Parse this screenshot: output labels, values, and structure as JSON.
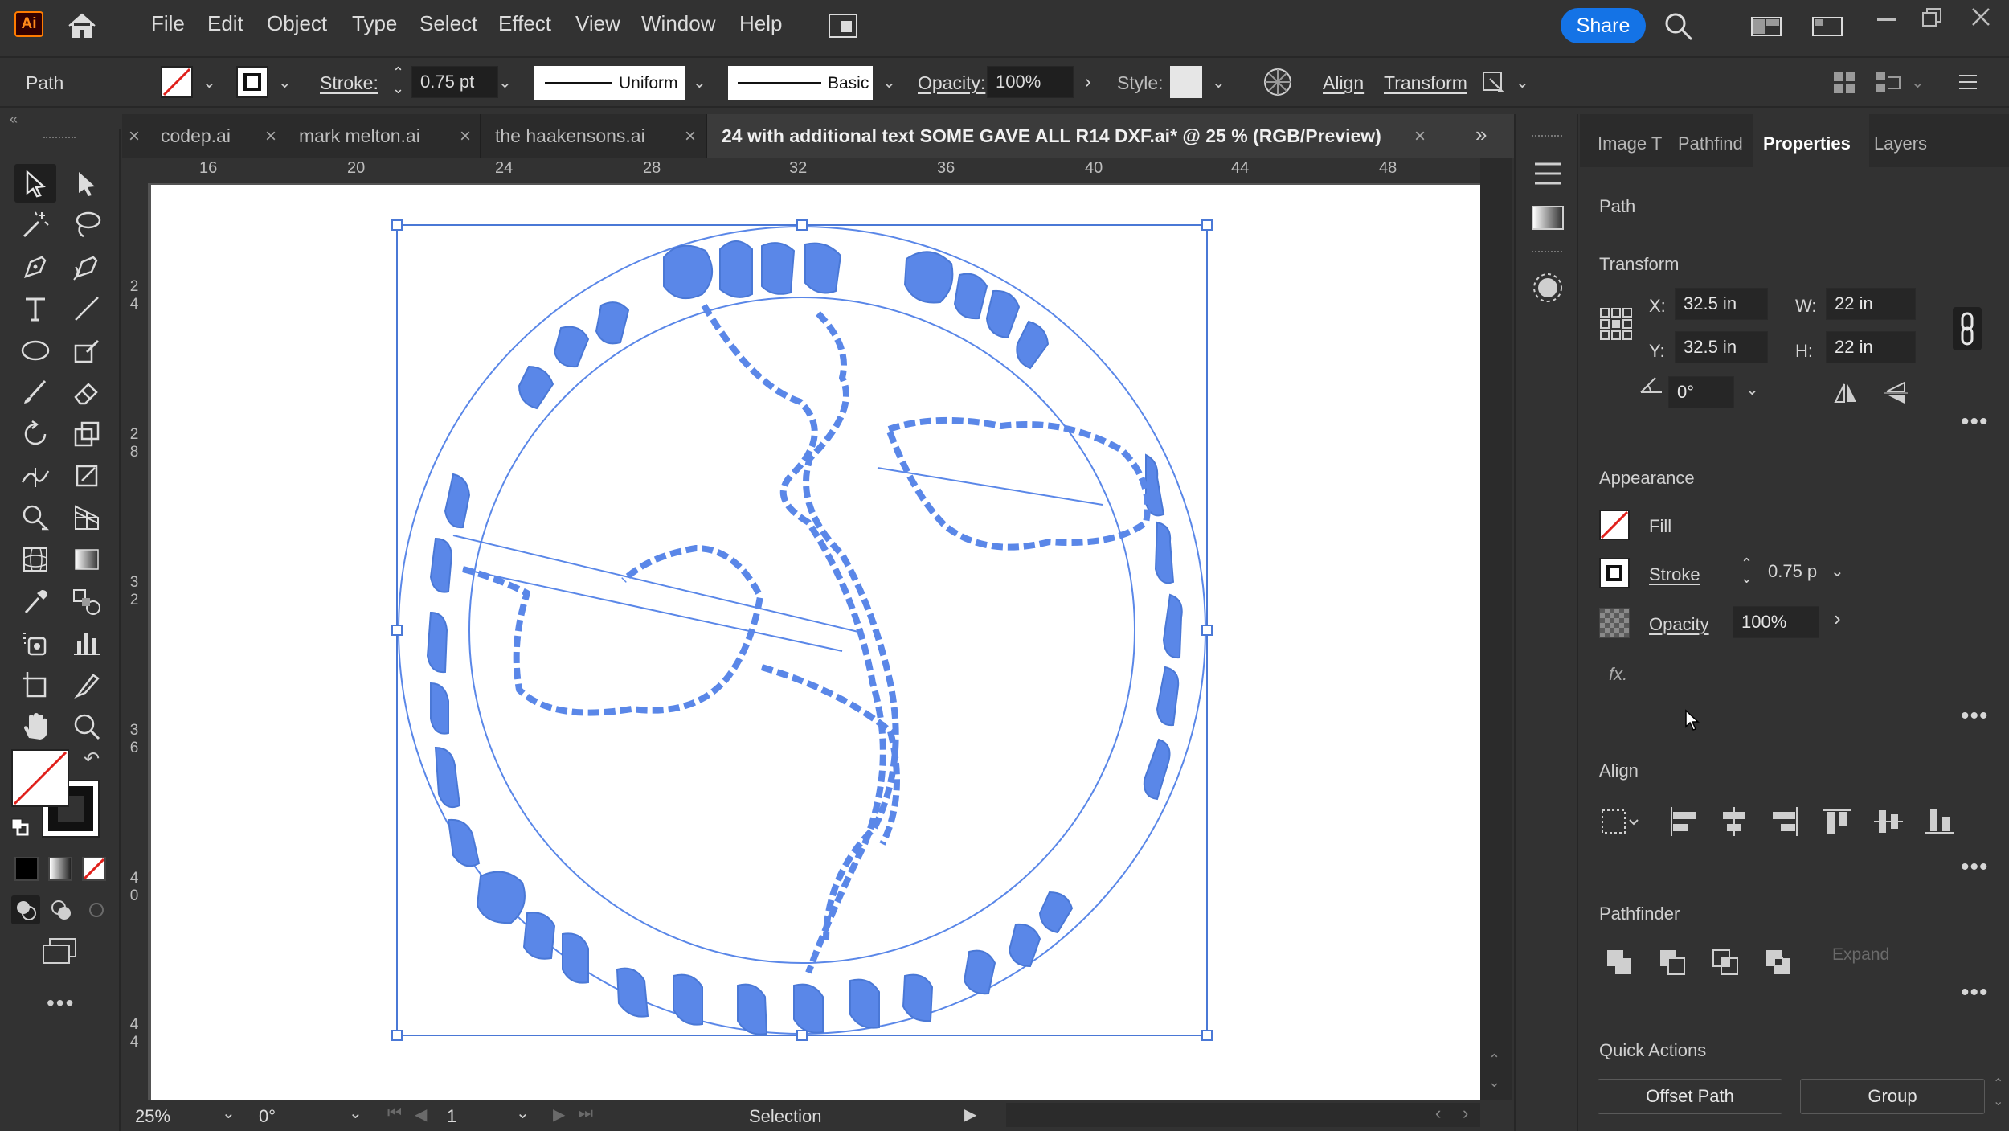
{
  "app": {
    "logo": "Ai",
    "share_label": "Share"
  },
  "menu": [
    "File",
    "Edit",
    "Object",
    "Type",
    "Select",
    "Effect",
    "View",
    "Window",
    "Help"
  ],
  "control": {
    "selection_type": "Path",
    "stroke_label": "Stroke:",
    "stroke_value": "0.75 pt",
    "profile": "Uniform",
    "brush": "Basic",
    "opacity_label": "Opacity:",
    "opacity_value": "100%",
    "style_label": "Style:",
    "align_label": "Align",
    "transform_label": "Transform"
  },
  "tabs": [
    {
      "label": "codep.ai",
      "active": false
    },
    {
      "label": "mark melton.ai",
      "active": false
    },
    {
      "label": "the haakensons.ai",
      "active": false
    },
    {
      "label": "24 with additional text SOME GAVE ALL R14 DXF.ai* @ 25 % (RGB/Preview)",
      "active": true
    }
  ],
  "ruler": {
    "h": [
      "16",
      "20",
      "24",
      "28",
      "32",
      "36",
      "40",
      "44",
      "48"
    ],
    "v": [
      [
        "2",
        "4"
      ],
      [
        "2",
        "8"
      ],
      [
        "3",
        "2"
      ],
      [
        "3",
        "6"
      ],
      [
        "4",
        "0"
      ],
      [
        "4",
        "4"
      ]
    ]
  },
  "status": {
    "zoom": "25%",
    "rotation": "0°",
    "artboard": "1",
    "tool": "Selection"
  },
  "panel": {
    "tabs": [
      "Image T",
      "Pathfind",
      "Properties",
      "Layers"
    ],
    "active_tab": "Properties",
    "object_type": "Path",
    "transform": {
      "title": "Transform",
      "x_label": "X:",
      "x": "32.5 in",
      "y_label": "Y:",
      "y": "32.5 in",
      "w_label": "W:",
      "w": "22 in",
      "h_label": "H:",
      "h": "22 in",
      "angle": "0°"
    },
    "appearance": {
      "title": "Appearance",
      "fill_label": "Fill",
      "stroke_label": "Stroke",
      "stroke_value": "0.75 p",
      "opacity_label": "Opacity",
      "opacity_value": "100%",
      "fx": "fx."
    },
    "align": {
      "title": "Align"
    },
    "pathfinder": {
      "title": "Pathfinder",
      "expand_label": "Expand"
    },
    "quick_actions": {
      "title": "Quick Actions",
      "offset_path": "Offset Path",
      "group": "Group"
    }
  },
  "colors": {
    "ui_bg": "#323232",
    "accent": "#1473e6",
    "artwork": "#5a87e8",
    "selection": "#4a78d6"
  }
}
